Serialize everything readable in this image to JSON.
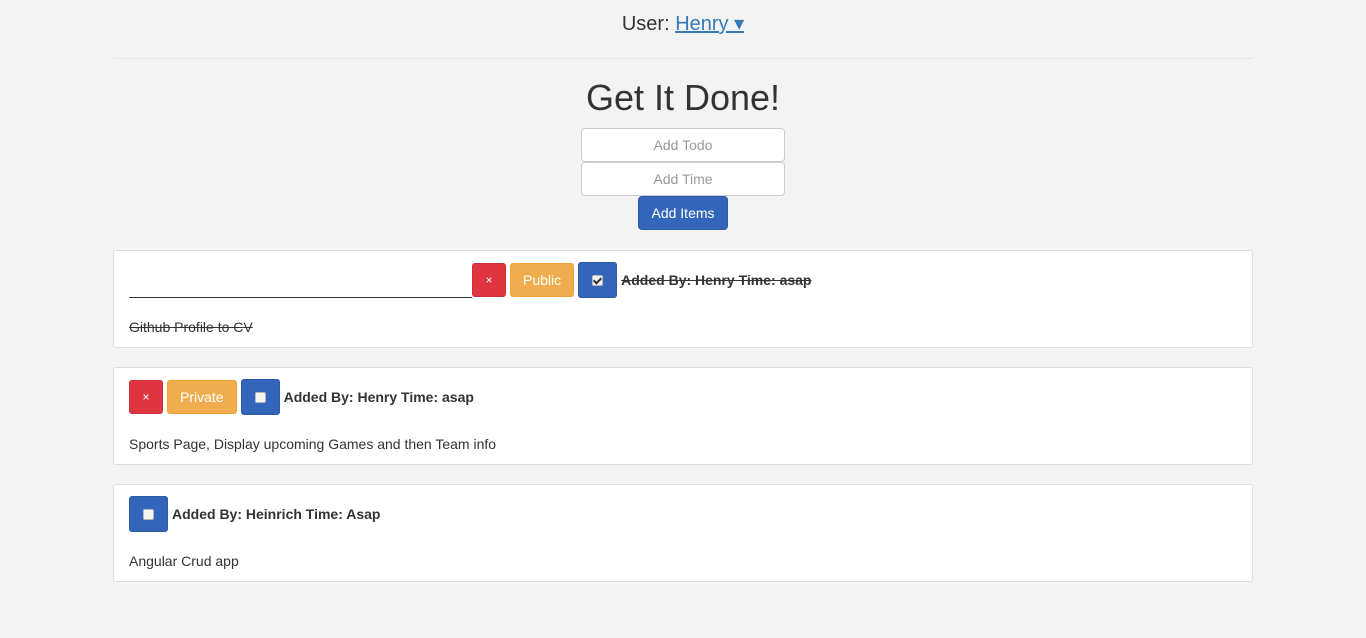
{
  "header": {
    "user_prefix": "User:",
    "user_name": "Henry ▾"
  },
  "title": "Get It Done!",
  "form": {
    "todo_placeholder": "Add Todo",
    "time_placeholder": "Add Time",
    "add_button": "Add Items"
  },
  "items": [
    {
      "delete_label": "×",
      "visibility_label": "Public",
      "done": true,
      "meta": "Added By: Henry Time: asap",
      "text": "Github Profile to CV"
    },
    {
      "delete_label": "×",
      "visibility_label": "Private",
      "done": false,
      "meta": "Added By: Henry Time: asap",
      "text": "Sports Page, Display upcoming Games and then Team info"
    },
    {
      "done": false,
      "meta": "Added By: Heinrich Time: Asap",
      "text": "Angular Crud app"
    }
  ],
  "colors": {
    "primary": "#3366bb",
    "danger": "#e0343f",
    "warning": "#f0ad4e",
    "link": "#337ab7"
  }
}
